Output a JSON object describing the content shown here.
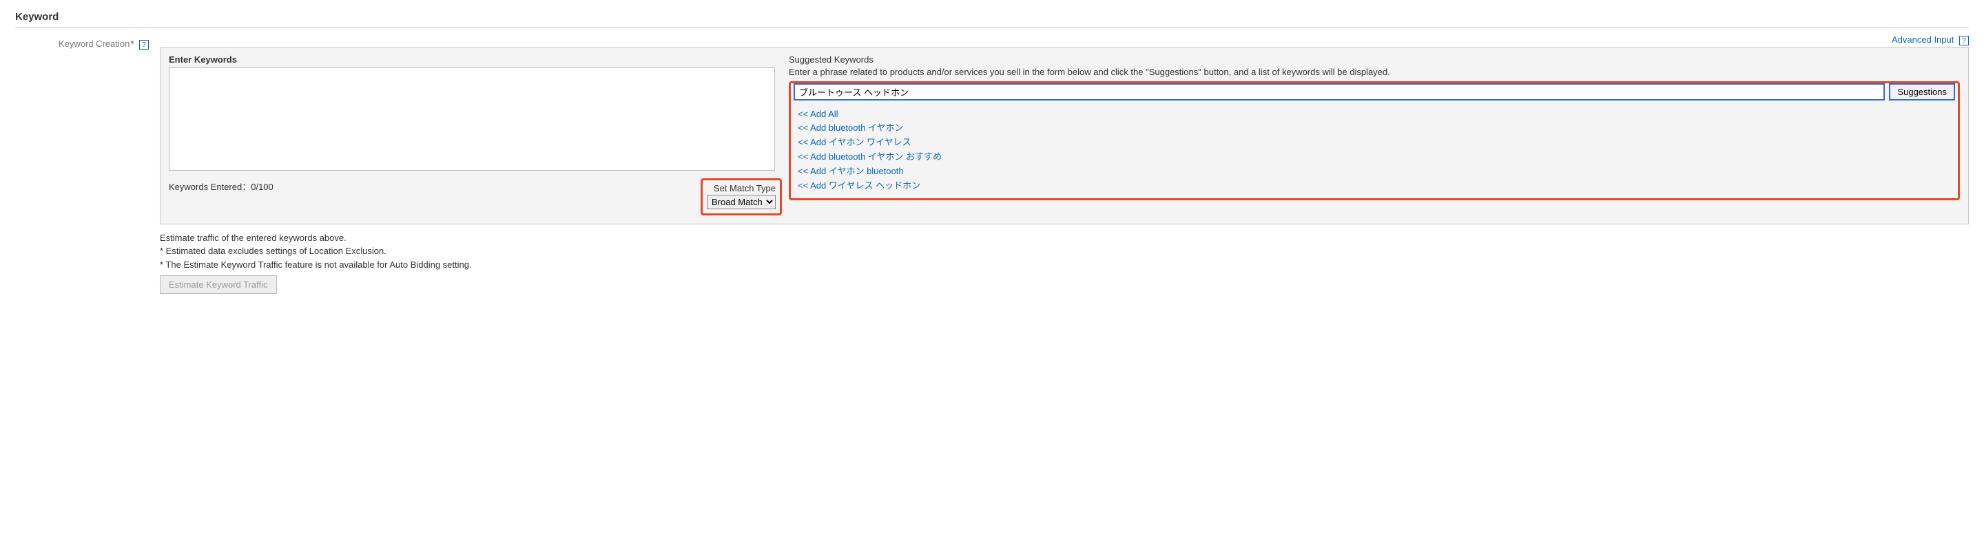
{
  "section_title": "Keyword",
  "label": "Keyword Creation",
  "advanced_input": "Advanced Input",
  "enter_heading": "Enter Keywords",
  "count_text": "Keywords Entered：0/100",
  "match_type": {
    "label": "Set Match Type",
    "selected": "Broad Match"
  },
  "suggested": {
    "title": "Suggested Keywords",
    "desc": "Enter a phrase related to products and/or services you sell in the form below and click the \"Suggestions\" button, and a list of keywords will be displayed.",
    "input_value": "ブルートゥース ヘッドホン",
    "button": "Suggestions",
    "add_prefix": "<< Add",
    "add_all": "All",
    "items": [
      "bluetooth イヤホン",
      "イヤホン ワイヤレス",
      "bluetooth イヤホン おすすめ",
      "イヤホン bluetooth",
      "ワイヤレス ヘッドホン"
    ]
  },
  "notes": {
    "line1": "Estimate traffic of the entered keywords above.",
    "line2": "* Estimated data excludes settings of Location Exclusion.",
    "line3": "* The Estimate Keyword Traffic feature is not available for Auto Bidding setting."
  },
  "estimate_button": "Estimate Keyword Traffic",
  "help_glyph": "?"
}
